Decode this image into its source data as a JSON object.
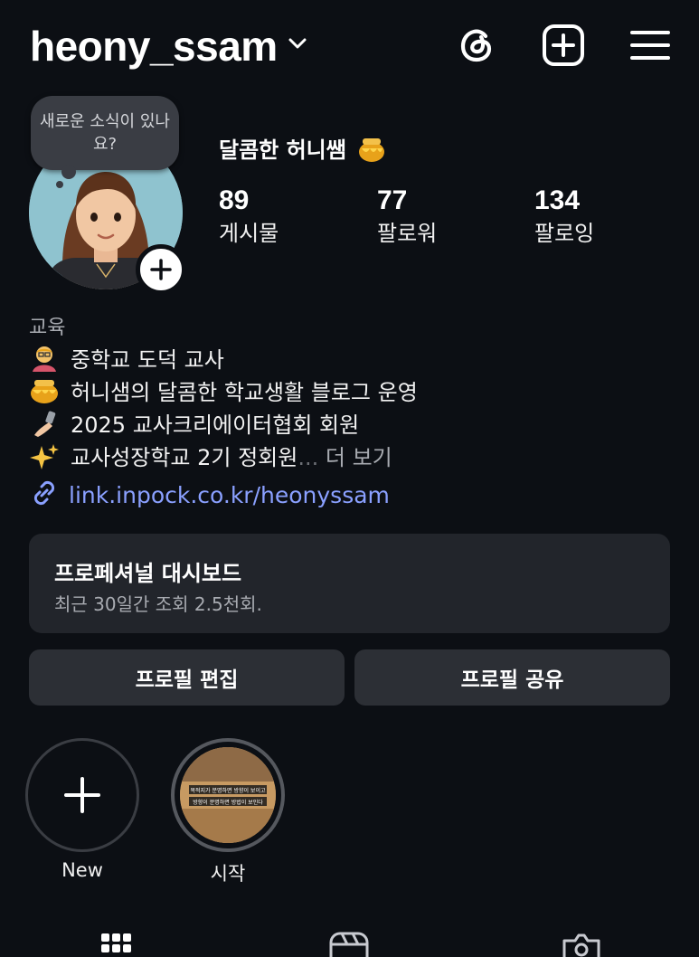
{
  "header": {
    "username": "heony_ssam",
    "icons": [
      "chevron-down-icon",
      "threads-icon",
      "create-plus-icon",
      "menu-icon"
    ]
  },
  "note": {
    "text": "새로운 소식이 있나요?"
  },
  "profile": {
    "display_name": "달콤한 허니쌤",
    "stats": [
      {
        "value": "89",
        "label": "게시물"
      },
      {
        "value": "77",
        "label": "팔로워"
      },
      {
        "value": "134",
        "label": "팔로잉"
      }
    ]
  },
  "bio": {
    "category": "교육",
    "lines": [
      {
        "icon": "teacher-emoji",
        "text": "중학교 도덕 교사"
      },
      {
        "icon": "honey-pot-emoji",
        "text": "허니샘의 달콤한 학교생활 블로그 운영"
      },
      {
        "icon": "selfie-emoji",
        "text": "2025 교사크리에이터협회 회원"
      },
      {
        "icon": "sparkles-emoji",
        "text": "교사성장학교 2기 정회원"
      }
    ],
    "ellipsis": "...",
    "more": "더 보기",
    "link": "link.inpock.co.kr/heonyssam"
  },
  "dashboard": {
    "title": "프로페셔널 대시보드",
    "subtitle": "최근 30일간 조회 2.5천회."
  },
  "buttons": {
    "edit": "프로필 편집",
    "share": "프로필 공유"
  },
  "highlights": [
    {
      "label": "New"
    },
    {
      "label": "시작",
      "caption1": "목적지가 분명하면 방향이 보이고",
      "caption2": "방향이 분명하면 방법이 보인다"
    }
  ],
  "colors": {
    "background": "#0c0f14",
    "card": "#22252b",
    "button": "#2c2f35",
    "link": "#8aa0ff",
    "muted": "#a8abb1"
  }
}
